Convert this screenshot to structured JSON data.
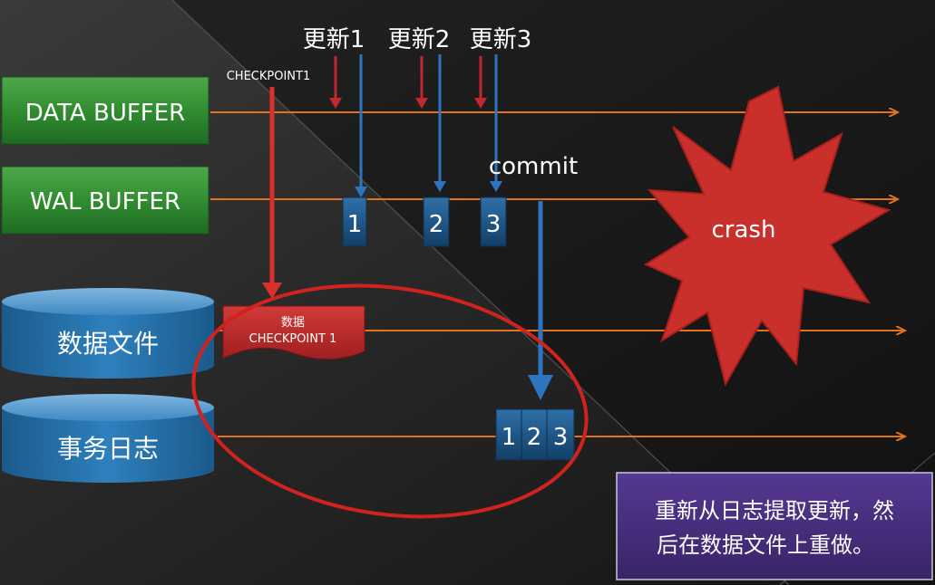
{
  "buffers": {
    "data_buffer": "DATA BUFFER",
    "wal_buffer": "WAL BUFFER"
  },
  "storage": {
    "data_file": "数据文件",
    "transaction_log": "事务日志"
  },
  "updates": [
    "更新1",
    "更新2",
    "更新3"
  ],
  "checkpoint_label": "CHECKPOINT1",
  "wal_records": [
    "1",
    "2",
    "3"
  ],
  "commit_label": "commit",
  "data_tag": {
    "line1": "数据",
    "line2": "CHECKPOINT 1"
  },
  "log_records": [
    "1",
    "2",
    "3"
  ],
  "crash_label": "crash",
  "note": {
    "line1": "重新从日志提取更新，然",
    "line2": "后在数据文件上重做。"
  },
  "colors": {
    "timeline": "#e0731f",
    "buffer_green": "#2e8b2e",
    "cylinder_blue": "#1f6aa0",
    "update_red": "#c0282e",
    "arrow_blue": "#2f74c0",
    "crash_red": "#c9302c",
    "note_purple": "#4a2f7e"
  }
}
